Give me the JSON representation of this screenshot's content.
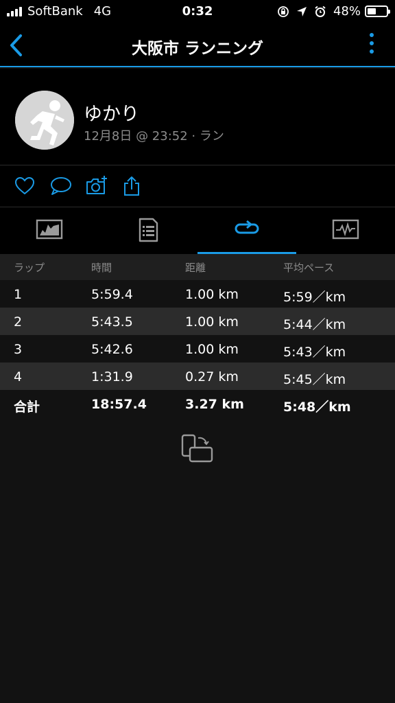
{
  "status_bar": {
    "carrier": "SoftBank",
    "network": "4G",
    "time": "0:32",
    "battery_percent": "48%",
    "battery_level": 0.48
  },
  "nav": {
    "title": "大阪市 ランニング",
    "back_icon": "chevron-left-icon",
    "more_icon": "more-vertical-icon",
    "accent_color": "#1a9be6"
  },
  "activity": {
    "user_name": "ゆかり",
    "meta": "12月8日 @ 23:52 · ラン",
    "avatar_icon": "runner-icon"
  },
  "actions": [
    "heart-icon",
    "comment-icon",
    "camera-add-icon",
    "share-icon"
  ],
  "tabs": [
    {
      "icon": "chart-icon",
      "active": false
    },
    {
      "icon": "document-list-icon",
      "active": false
    },
    {
      "icon": "laps-loop-icon",
      "active": true
    },
    {
      "icon": "activity-graph-icon",
      "active": false
    }
  ],
  "lap_table": {
    "headers": [
      "ラップ",
      "時間",
      "距離",
      "平均ペース"
    ],
    "rows": [
      [
        "1",
        "5:59.4",
        "1.00 km",
        "5:59／km"
      ],
      [
        "2",
        "5:43.5",
        "1.00 km",
        "5:44／km"
      ],
      [
        "3",
        "5:42.6",
        "1.00 km",
        "5:43／km"
      ],
      [
        "4",
        "1:31.9",
        "0.27 km",
        "5:45／km"
      ]
    ],
    "total": [
      "合計",
      "18:57.4",
      "3.27 km",
      "5:48／km"
    ]
  },
  "rotate_icon": "rotate-screen-icon"
}
